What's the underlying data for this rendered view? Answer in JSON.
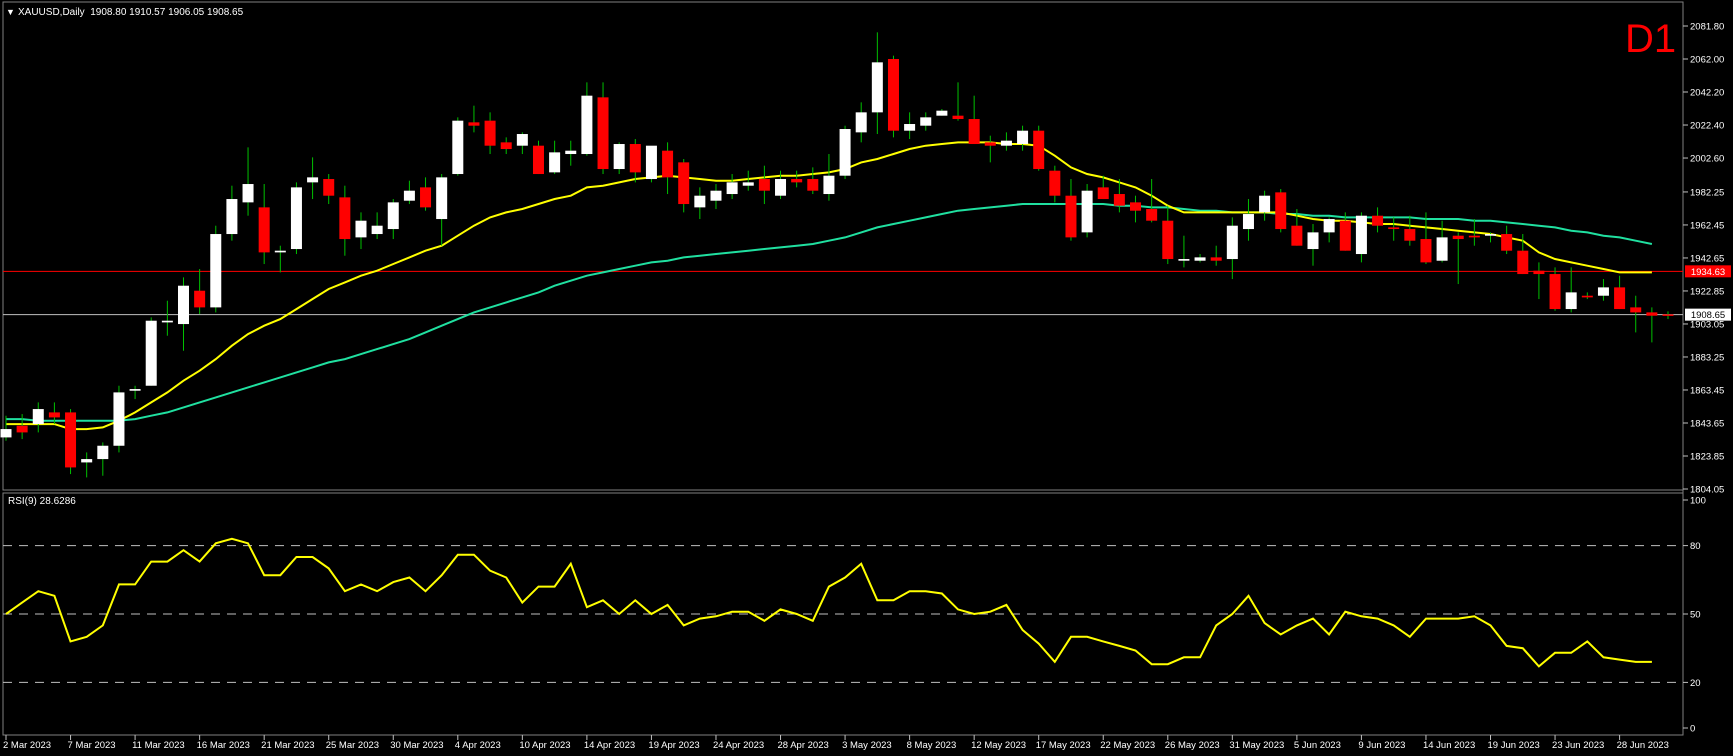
{
  "header": {
    "arrow": "▼",
    "symbol_info": "XAUUSD,Daily  1908.80 1910.57 1906.05 1908.65"
  },
  "timeframe_badge": "D1",
  "colors": {
    "background": "#000000",
    "bull_candle": "#ffffff",
    "bear_candle": "#ff0000",
    "wick": "#00c000",
    "ma_fast": "#ffff00",
    "ma_slow": "#20e0a0",
    "rsi_line": "#ffff00",
    "resistance_line": "#ff0000",
    "price_line": "#c0c0c0",
    "grid_dash": "#c0c0c0",
    "axis_text": "#ffffff",
    "badge": "#ff0000"
  },
  "price_axis": {
    "ticks": [
      "2081.80",
      "2062.00",
      "2042.20",
      "2022.40",
      "2002.60",
      "1982.25",
      "1962.45",
      "1942.65",
      "1922.85",
      "1903.05",
      "1883.25",
      "1863.45",
      "1843.65",
      "1823.85",
      "1804.05"
    ]
  },
  "price_labels": {
    "resistance": "1934.63",
    "current": "1908.65"
  },
  "rsi_panel": {
    "label": "RSI(9) 28.6286",
    "ticks": [
      "100",
      "80",
      "50",
      "20",
      "0"
    ]
  },
  "date_axis": {
    "ticks": [
      "2 Mar 2023",
      "7 Mar 2023",
      "11 Mar 2023",
      "16 Mar 2023",
      "21 Mar 2023",
      "25 Mar 2023",
      "30 Mar 2023",
      "4 Apr 2023",
      "10 Apr 2023",
      "14 Apr 2023",
      "19 Apr 2023",
      "24 Apr 2023",
      "28 Apr 2023",
      "3 May 2023",
      "8 May 2023",
      "12 May 2023",
      "17 May 2023",
      "22 May 2023",
      "26 May 2023",
      "31 May 2023",
      "5 Jun 2023",
      "9 Jun 2023",
      "14 Jun 2023",
      "19 Jun 2023",
      "23 Jun 2023",
      "28 Jun 2023"
    ]
  },
  "chart_data": {
    "type": "candlestick",
    "symbol": "XAUUSD",
    "timeframe": "Daily",
    "ylim": [
      1804.05,
      2090
    ],
    "horizontal_levels": [
      1934.63,
      1908.65
    ],
    "candles": [
      {
        "o": 1835,
        "h": 1848,
        "l": 1833,
        "c": 1840
      },
      {
        "o": 1842,
        "h": 1849,
        "l": 1834,
        "c": 1838
      },
      {
        "o": 1843,
        "h": 1856,
        "l": 1838,
        "c": 1852
      },
      {
        "o": 1850,
        "h": 1856,
        "l": 1843,
        "c": 1847
      },
      {
        "o": 1850,
        "h": 1852,
        "l": 1813,
        "c": 1817
      },
      {
        "o": 1820,
        "h": 1826,
        "l": 1811,
        "c": 1822
      },
      {
        "o": 1822,
        "h": 1832,
        "l": 1812,
        "c": 1830
      },
      {
        "o": 1830,
        "h": 1866,
        "l": 1826,
        "c": 1862
      },
      {
        "o": 1863,
        "h": 1866,
        "l": 1858,
        "c": 1864
      },
      {
        "o": 1866,
        "h": 1907,
        "l": 1866,
        "c": 1905
      },
      {
        "o": 1904,
        "h": 1917,
        "l": 1896,
        "c": 1905
      },
      {
        "o": 1903,
        "h": 1931,
        "l": 1887,
        "c": 1926
      },
      {
        "o": 1923,
        "h": 1936,
        "l": 1909,
        "c": 1913
      },
      {
        "o": 1913,
        "h": 1962,
        "l": 1910,
        "c": 1957
      },
      {
        "o": 1957,
        "h": 1986,
        "l": 1953,
        "c": 1978
      },
      {
        "o": 1976,
        "h": 2009,
        "l": 1968,
        "c": 1987
      },
      {
        "o": 1973,
        "h": 1987,
        "l": 1939,
        "c": 1946
      },
      {
        "o": 1946,
        "h": 1950,
        "l": 1934,
        "c": 1947
      },
      {
        "o": 1948,
        "h": 1988,
        "l": 1945,
        "c": 1985
      },
      {
        "o": 1988,
        "h": 2003,
        "l": 1978,
        "c": 1991
      },
      {
        "o": 1990,
        "h": 1993,
        "l": 1975,
        "c": 1980
      },
      {
        "o": 1979,
        "h": 1986,
        "l": 1944,
        "c": 1954
      },
      {
        "o": 1955,
        "h": 1970,
        "l": 1948,
        "c": 1965
      },
      {
        "o": 1957,
        "h": 1970,
        "l": 1954,
        "c": 1962
      },
      {
        "o": 1960,
        "h": 1978,
        "l": 1954,
        "c": 1976
      },
      {
        "o": 1977,
        "h": 1989,
        "l": 1975,
        "c": 1983
      },
      {
        "o": 1985,
        "h": 1991,
        "l": 1971,
        "c": 1973
      },
      {
        "o": 1966,
        "h": 1993,
        "l": 1950,
        "c": 1991
      },
      {
        "o": 1993,
        "h": 2027,
        "l": 1992,
        "c": 2025
      },
      {
        "o": 2024,
        "h": 2034,
        "l": 2018,
        "c": 2022
      },
      {
        "o": 2025,
        "h": 2030,
        "l": 2005,
        "c": 2010
      },
      {
        "o": 2012,
        "h": 2015,
        "l": 2005,
        "c": 2008
      },
      {
        "o": 2010,
        "h": 2018,
        "l": 2005,
        "c": 2017
      },
      {
        "o": 2010,
        "h": 2013,
        "l": 1993,
        "c": 1993
      },
      {
        "o": 1994,
        "h": 2013,
        "l": 1993,
        "c": 2006
      },
      {
        "o": 2005,
        "h": 2013,
        "l": 1998,
        "c": 2007
      },
      {
        "o": 2005,
        "h": 2048,
        "l": 2004,
        "c": 2040
      },
      {
        "o": 2039,
        "h": 2048,
        "l": 1993,
        "c": 1996
      },
      {
        "o": 1996,
        "h": 2012,
        "l": 1993,
        "c": 2011
      },
      {
        "o": 2011,
        "h": 2014,
        "l": 1988,
        "c": 1994
      },
      {
        "o": 1990,
        "h": 2009,
        "l": 1988,
        "c": 2010
      },
      {
        "o": 2007,
        "h": 2012,
        "l": 1981,
        "c": 1991
      },
      {
        "o": 2000,
        "h": 2002,
        "l": 1970,
        "c": 1975
      },
      {
        "o": 1973,
        "h": 1985,
        "l": 1966,
        "c": 1980
      },
      {
        "o": 1977,
        "h": 1987,
        "l": 1972,
        "c": 1983
      },
      {
        "o": 1981,
        "h": 1993,
        "l": 1978,
        "c": 1988
      },
      {
        "o": 1986,
        "h": 1995,
        "l": 1983,
        "c": 1988
      },
      {
        "o": 1990,
        "h": 1998,
        "l": 1975,
        "c": 1983
      },
      {
        "o": 1980,
        "h": 1995,
        "l": 1978,
        "c": 1990
      },
      {
        "o": 1990,
        "h": 1995,
        "l": 1985,
        "c": 1988
      },
      {
        "o": 1990,
        "h": 1997,
        "l": 1981,
        "c": 1983
      },
      {
        "o": 1981,
        "h": 2005,
        "l": 1977,
        "c": 1992
      },
      {
        "o": 1992,
        "h": 2022,
        "l": 1990,
        "c": 2020
      },
      {
        "o": 2018,
        "h": 2036,
        "l": 2012,
        "c": 2030
      },
      {
        "o": 2030,
        "h": 2078,
        "l": 2017,
        "c": 2060
      },
      {
        "o": 2062,
        "h": 2064,
        "l": 2015,
        "c": 2019
      },
      {
        "o": 2019,
        "h": 2030,
        "l": 2014,
        "c": 2023
      },
      {
        "o": 2022,
        "h": 2030,
        "l": 2019,
        "c": 2027
      },
      {
        "o": 2028,
        "h": 2032,
        "l": 2028,
        "c": 2031
      },
      {
        "o": 2028,
        "h": 2048,
        "l": 2025,
        "c": 2026
      },
      {
        "o": 2026,
        "h": 2040,
        "l": 2011,
        "c": 2011
      },
      {
        "o": 2012,
        "h": 2016,
        "l": 2000,
        "c": 2010
      },
      {
        "o": 2010,
        "h": 2018,
        "l": 2007,
        "c": 2013
      },
      {
        "o": 2011,
        "h": 2022,
        "l": 2007,
        "c": 2019
      },
      {
        "o": 2019,
        "h": 2022,
        "l": 1995,
        "c": 1996
      },
      {
        "o": 1995,
        "h": 1998,
        "l": 1976,
        "c": 1980
      },
      {
        "o": 1980,
        "h": 1990,
        "l": 1953,
        "c": 1955
      },
      {
        "o": 1958,
        "h": 1987,
        "l": 1955,
        "c": 1983
      },
      {
        "o": 1985,
        "h": 1992,
        "l": 1978,
        "c": 1978
      },
      {
        "o": 1981,
        "h": 1990,
        "l": 1970,
        "c": 1974
      },
      {
        "o": 1976,
        "h": 1980,
        "l": 1964,
        "c": 1971
      },
      {
        "o": 1972,
        "h": 1990,
        "l": 1964,
        "c": 1965
      },
      {
        "o": 1965,
        "h": 1974,
        "l": 1939,
        "c": 1942
      },
      {
        "o": 1941,
        "h": 1956,
        "l": 1937,
        "c": 1942
      },
      {
        "o": 1941,
        "h": 1945,
        "l": 1940,
        "c": 1943
      },
      {
        "o": 1943,
        "h": 1950,
        "l": 1938,
        "c": 1941
      },
      {
        "o": 1942,
        "h": 1967,
        "l": 1930,
        "c": 1962
      },
      {
        "o": 1960,
        "h": 1978,
        "l": 1953,
        "c": 1969
      },
      {
        "o": 1970,
        "h": 1983,
        "l": 1965,
        "c": 1980
      },
      {
        "o": 1982,
        "h": 1984,
        "l": 1958,
        "c": 1960
      },
      {
        "o": 1962,
        "h": 1972,
        "l": 1950,
        "c": 1950
      },
      {
        "o": 1948,
        "h": 1963,
        "l": 1938,
        "c": 1958
      },
      {
        "o": 1958,
        "h": 1967,
        "l": 1952,
        "c": 1966
      },
      {
        "o": 1965,
        "h": 1970,
        "l": 1947,
        "c": 1947
      },
      {
        "o": 1945,
        "h": 1970,
        "l": 1940,
        "c": 1968
      },
      {
        "o": 1968,
        "h": 1973,
        "l": 1958,
        "c": 1962
      },
      {
        "o": 1961,
        "h": 1967,
        "l": 1953,
        "c": 1960
      },
      {
        "o": 1960,
        "h": 1968,
        "l": 1950,
        "c": 1953
      },
      {
        "o": 1954,
        "h": 1970,
        "l": 1939,
        "c": 1940
      },
      {
        "o": 1941,
        "h": 1965,
        "l": 1940,
        "c": 1955
      },
      {
        "o": 1956,
        "h": 1958,
        "l": 1927,
        "c": 1954
      },
      {
        "o": 1956,
        "h": 1966,
        "l": 1950,
        "c": 1955
      },
      {
        "o": 1956,
        "h": 1958,
        "l": 1952,
        "c": 1957
      },
      {
        "o": 1957,
        "h": 1962,
        "l": 1945,
        "c": 1947
      },
      {
        "o": 1947,
        "h": 1957,
        "l": 1933,
        "c": 1933
      },
      {
        "o": 1935,
        "h": 1940,
        "l": 1918,
        "c": 1933
      },
      {
        "o": 1933,
        "h": 1937,
        "l": 1911,
        "c": 1912
      },
      {
        "o": 1912,
        "h": 1937,
        "l": 1910,
        "c": 1922
      },
      {
        "o": 1920,
        "h": 1922,
        "l": 1918,
        "c": 1919
      },
      {
        "o": 1920,
        "h": 1930,
        "l": 1917,
        "c": 1925
      },
      {
        "o": 1925,
        "h": 1932,
        "l": 1912,
        "c": 1912
      },
      {
        "o": 1913,
        "h": 1920,
        "l": 1898,
        "c": 1910
      },
      {
        "o": 1910,
        "h": 1913,
        "l": 1892,
        "c": 1908
      },
      {
        "o": 1908.8,
        "h": 1910.57,
        "l": 1906.05,
        "c": 1908.65
      }
    ],
    "ma_fast": [
      1843,
      1843,
      1843,
      1843,
      1840,
      1840,
      1841,
      1845,
      1850,
      1856,
      1862,
      1869,
      1875,
      1882,
      1890,
      1897,
      1902,
      1906,
      1912,
      1918,
      1924,
      1928,
      1932,
      1935,
      1939,
      1943,
      1947,
      1950,
      1956,
      1962,
      1967,
      1970,
      1972,
      1975,
      1978,
      1980,
      1985,
      1986,
      1988,
      1990,
      1991,
      1992,
      1991,
      1990,
      1989,
      1989,
      1990,
      1991,
      1992,
      1992,
      1993,
      1994,
      1996,
      2000,
      2002,
      2005,
      2008,
      2010,
      2011,
      2012,
      2012,
      2012,
      2011,
      2011,
      2010,
      2004,
      1997,
      1993,
      1991,
      1988,
      1985,
      1980,
      1974,
      1970,
      1970,
      1970,
      1970,
      1970,
      1970,
      1970,
      1968,
      1966,
      1965,
      1965,
      1964,
      1963,
      1963,
      1962,
      1961,
      1960,
      1959,
      1958,
      1957,
      1955,
      1953,
      1946,
      1942,
      1940,
      1938,
      1936,
      1934,
      1934,
      1934
    ],
    "ma_slow": [
      1846,
      1846,
      1845,
      1845,
      1845,
      1845,
      1845,
      1845,
      1846,
      1848,
      1850,
      1853,
      1856,
      1859,
      1862,
      1865,
      1868,
      1871,
      1874,
      1877,
      1880,
      1882,
      1885,
      1888,
      1891,
      1894,
      1898,
      1902,
      1906,
      1910,
      1913,
      1916,
      1919,
      1922,
      1926,
      1929,
      1932,
      1934,
      1936,
      1938,
      1940,
      1941,
      1943,
      1944,
      1945,
      1946,
      1947,
      1948,
      1949,
      1950,
      1951,
      1953,
      1955,
      1958,
      1961,
      1963,
      1965,
      1967,
      1969,
      1971,
      1972,
      1973,
      1974,
      1975,
      1975,
      1975,
      1975,
      1975,
      1975,
      1974,
      1974,
      1973,
      1973,
      1972,
      1971,
      1971,
      1970,
      1970,
      1970,
      1969,
      1969,
      1968,
      1968,
      1967,
      1967,
      1967,
      1967,
      1967,
      1966,
      1966,
      1966,
      1965,
      1965,
      1964,
      1963,
      1962,
      1961,
      1959,
      1958,
      1956,
      1955,
      1953,
      1951
    ],
    "rsi": [
      50,
      55,
      60,
      58,
      38,
      40,
      45,
      63,
      63,
      73,
      73,
      78,
      73,
      81,
      83,
      81,
      67,
      67,
      75,
      75,
      70,
      60,
      63,
      60,
      64,
      66,
      60,
      67,
      76,
      76,
      69,
      66,
      55,
      62,
      62,
      72,
      53,
      56,
      50,
      56,
      50,
      54,
      45,
      48,
      49,
      51,
      51,
      47,
      52,
      50,
      47,
      62,
      66,
      72,
      56,
      56,
      60,
      60,
      59,
      52,
      50,
      51,
      54,
      43,
      37,
      29,
      40,
      40,
      38,
      36,
      34,
      28,
      28,
      31,
      31,
      45,
      50,
      58,
      46,
      41,
      45,
      48,
      41,
      51,
      49,
      48,
      45,
      40,
      48,
      48,
      48,
      49,
      45,
      36,
      35,
      27,
      33,
      33,
      38,
      31,
      30,
      29,
      29
    ]
  }
}
